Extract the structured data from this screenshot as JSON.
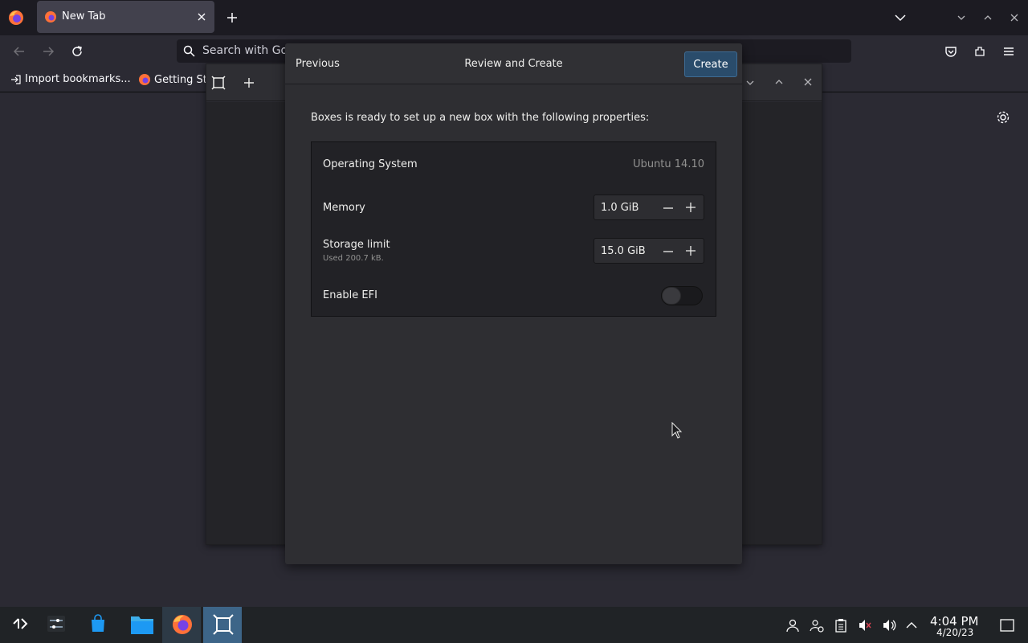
{
  "browser": {
    "tab": {
      "title": "New Tab"
    },
    "urlbar": {
      "placeholder": "Search with Google or enter address"
    },
    "bookmarks": [
      {
        "label": "Import bookmarks..."
      },
      {
        "label": "Getting Started"
      }
    ]
  },
  "dialog": {
    "header": {
      "previous_label": "Previous",
      "title": "Review and Create",
      "create_label": "Create"
    },
    "intro": "Boxes is ready to set up a new box with the following properties:",
    "properties": {
      "os": {
        "label": "Operating System",
        "value": "Ubuntu 14.10"
      },
      "memory": {
        "label": "Memory",
        "value": "1.0 GiB"
      },
      "storage": {
        "label": "Storage limit",
        "sublabel": "Used 200.7 kB.",
        "value": "15.0 GiB"
      },
      "efi": {
        "label": "Enable EFI",
        "enabled": false
      }
    }
  },
  "taskbar": {
    "time": "4:04 PM",
    "date": "4/20/23"
  },
  "colors": {
    "accent_button": "#2a4c6b",
    "taskbar_active": "#3d6588"
  }
}
